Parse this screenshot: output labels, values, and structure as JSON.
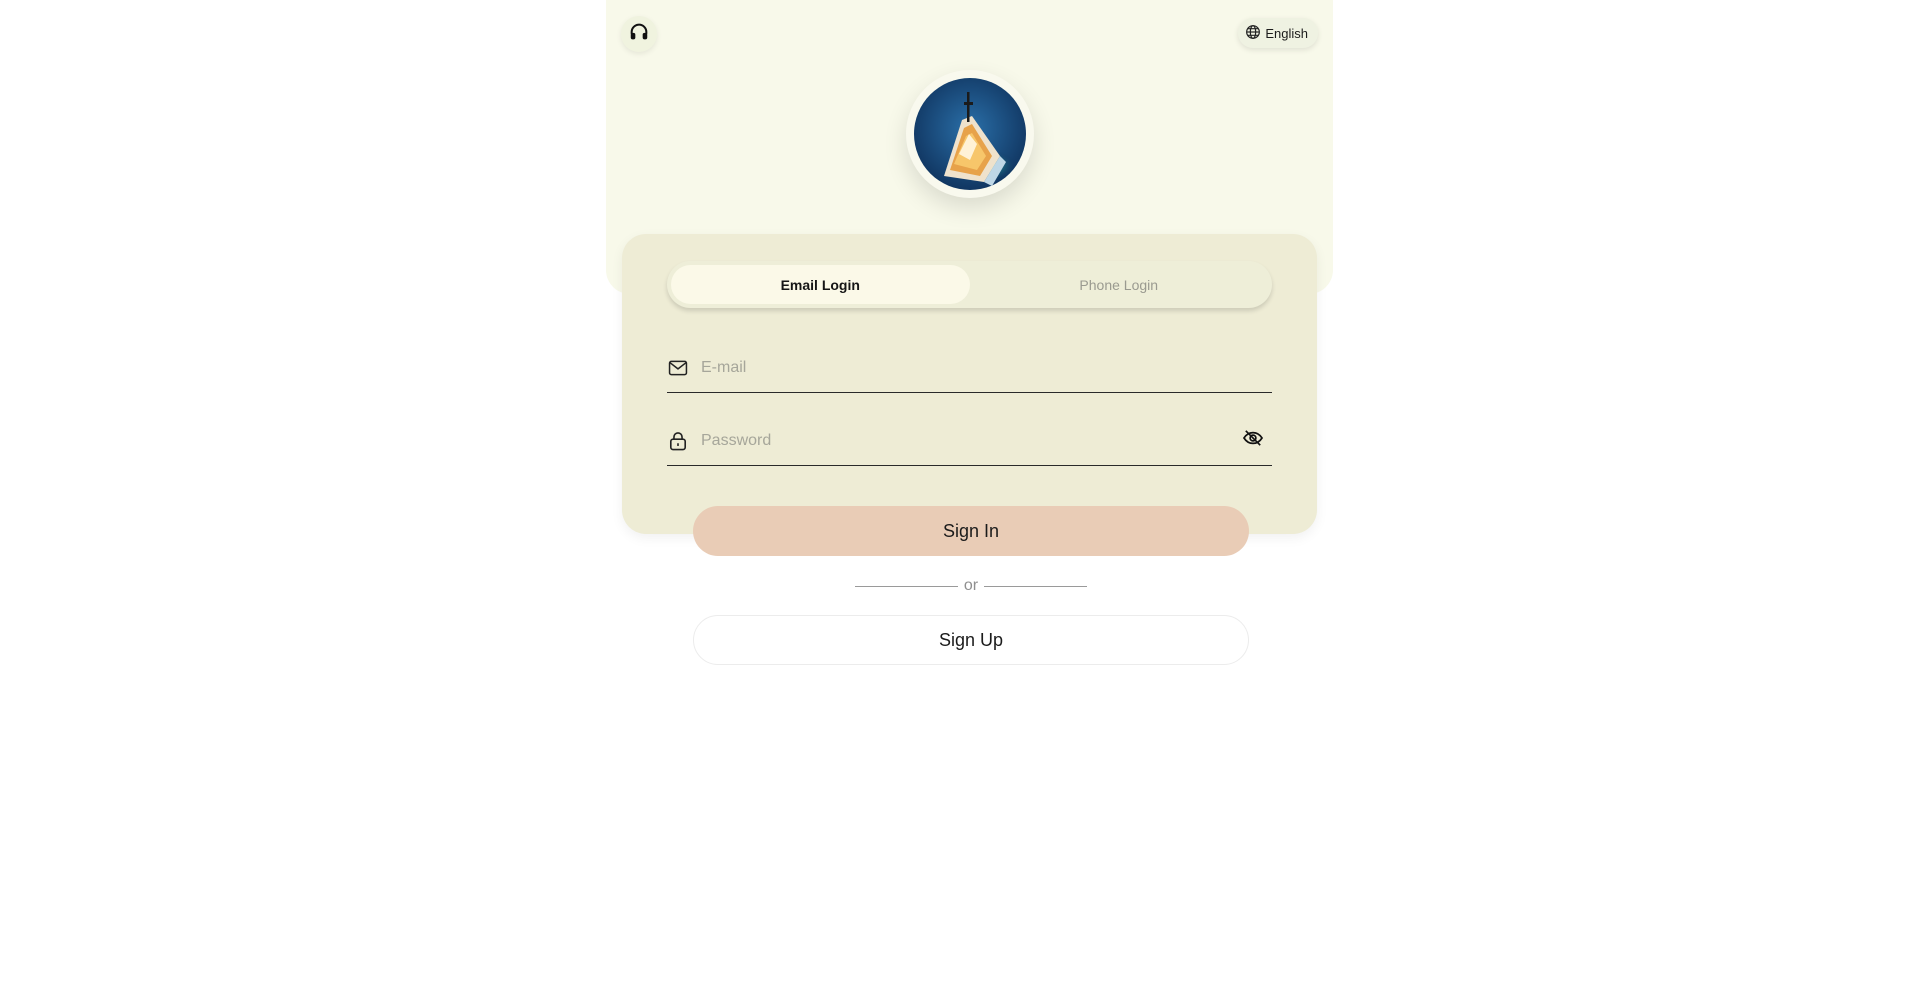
{
  "header": {
    "support_icon": "headset-icon",
    "language": {
      "icon": "globe-icon",
      "label": "English"
    }
  },
  "logo": {
    "icon": "yacht-logo"
  },
  "login": {
    "tabs": [
      {
        "label": "Email Login",
        "active": true
      },
      {
        "label": "Phone Login",
        "active": false
      }
    ],
    "email": {
      "icon": "mail-icon",
      "placeholder": "E-mail",
      "value": ""
    },
    "password": {
      "icon": "lock-icon",
      "placeholder": "Password",
      "value": "",
      "toggle_icon": "eye-off-icon"
    }
  },
  "actions": {
    "sign_in_label": "Sign In",
    "divider_label": "or",
    "sign_up_label": "Sign Up"
  },
  "colors": {
    "band": "#f8f9ea",
    "card": "#eeecd5",
    "sign_in": "#e9ccb6"
  }
}
